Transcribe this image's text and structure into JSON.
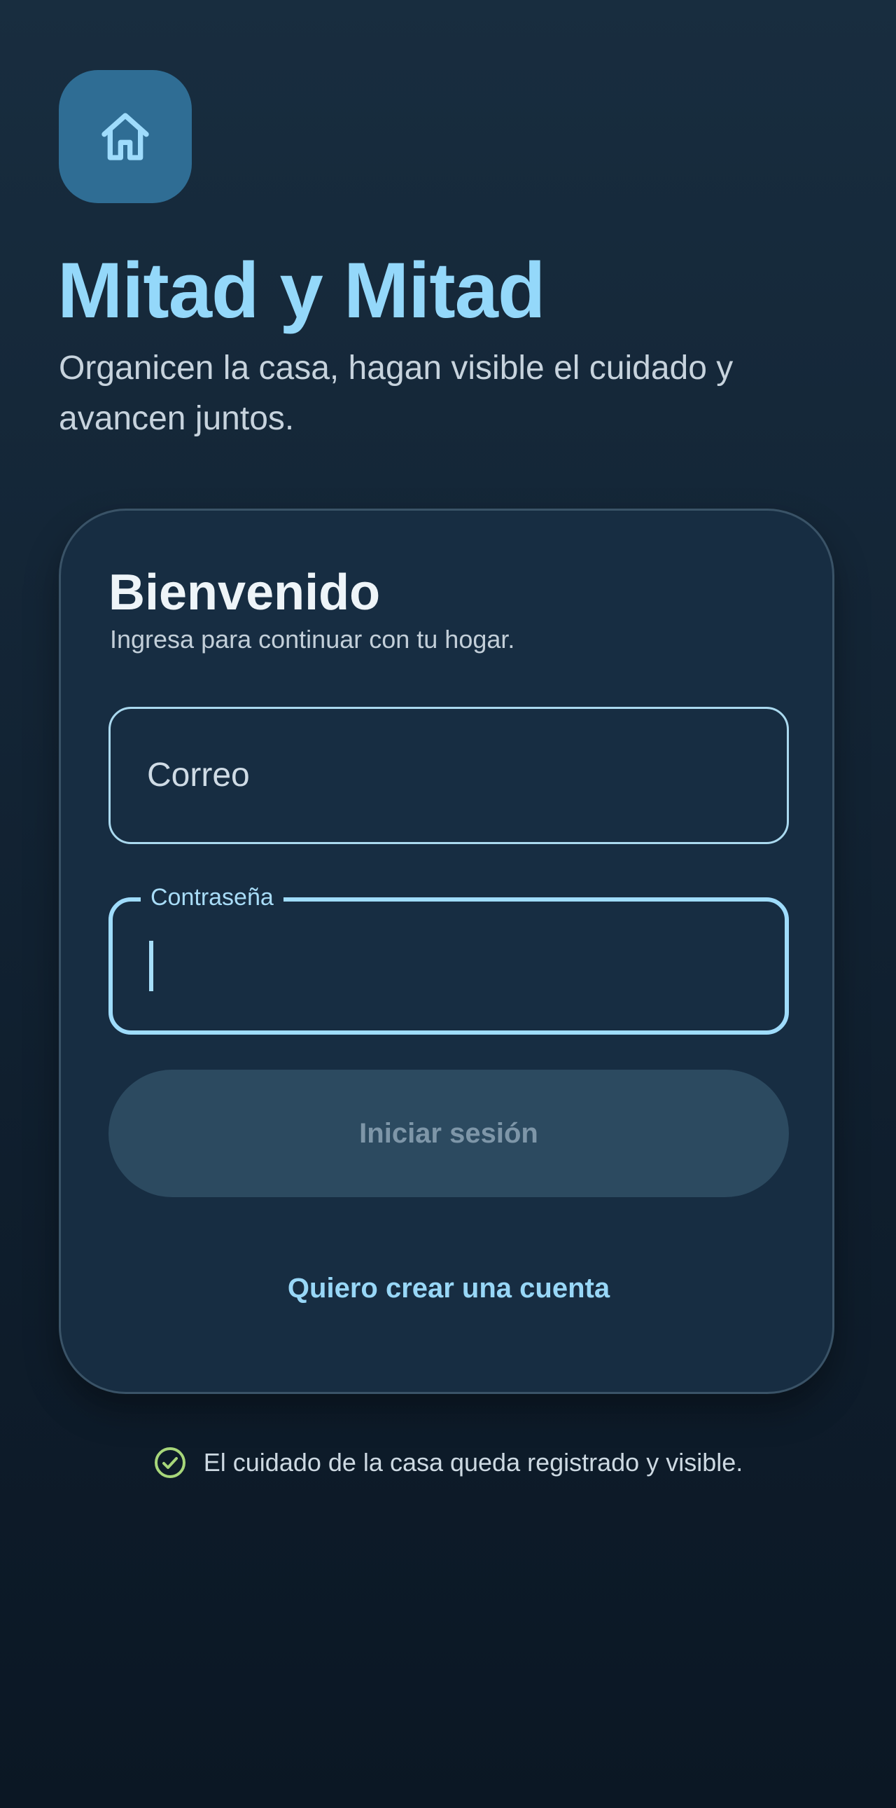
{
  "app": {
    "icon": "home-icon",
    "title": "Mitad y Mitad",
    "subtitle": "Organicen la casa, hagan visible el cuidado y avancen juntos."
  },
  "card": {
    "title": "Bienvenido",
    "subtitle": "Ingresa para continuar con tu hogar.",
    "email_field": {
      "placeholder": "Correo",
      "value": ""
    },
    "password_field": {
      "label": "Contraseña",
      "value": "",
      "focused": true
    },
    "login_button": {
      "label": "Iniciar sesión",
      "disabled": true
    },
    "create_account_link": "Quiero crear una cuenta"
  },
  "footer": {
    "icon": "check-circle-icon",
    "note": "El cuidado de la casa queda registrado y visible."
  },
  "colors": {
    "accent": "#94d8fa",
    "card_background": "#172d42",
    "app_icon_background": "#2f6d94",
    "button_disabled": "#2c4a60",
    "success": "#a7d67a"
  }
}
